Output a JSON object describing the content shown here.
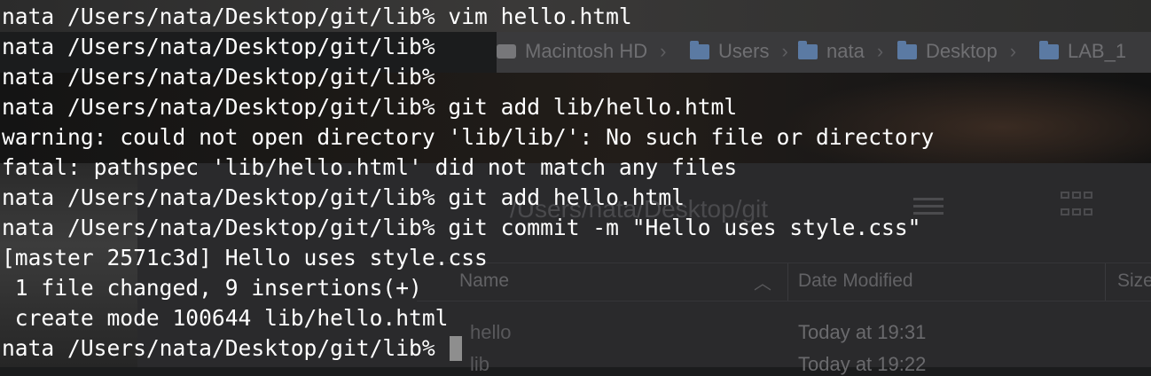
{
  "background": {
    "finder_path": [
      {
        "icon": "disk-icon",
        "label": "Macintosh HD"
      },
      {
        "icon": "folder-icon",
        "label": "Users"
      },
      {
        "icon": "folder-icon",
        "label": "nata"
      },
      {
        "icon": "folder-icon",
        "label": "Desktop"
      },
      {
        "icon": "folder-icon",
        "label": "LAB_1"
      }
    ],
    "window_title": "/Users/nata/Desktop/git",
    "columns": {
      "name": "Name",
      "date_modified": "Date Modified",
      "size": "Size"
    },
    "rows": [
      {
        "name": "hello",
        "date": "Today at 19:31"
      },
      {
        "name": "lib",
        "date": "Today at 19:22"
      }
    ]
  },
  "terminal": {
    "lines": [
      "nata /Users/nata/Desktop/git/lib% vim hello.html",
      "nata /Users/nata/Desktop/git/lib%",
      "nata /Users/nata/Desktop/git/lib%",
      "nata /Users/nata/Desktop/git/lib% git add lib/hello.html",
      "warning: could not open directory 'lib/lib/': No such file or directory",
      "fatal: pathspec 'lib/hello.html' did not match any files",
      "nata /Users/nata/Desktop/git/lib% git add hello.html",
      "nata /Users/nata/Desktop/git/lib% git commit -m \"Hello uses style.css\"",
      "[master 2571c3d] Hello uses style.css",
      " 1 file changed, 9 insertions(+)",
      " create mode 100644 lib/hello.html"
    ],
    "prompt": "nata /Users/nata/Desktop/git/lib% "
  }
}
